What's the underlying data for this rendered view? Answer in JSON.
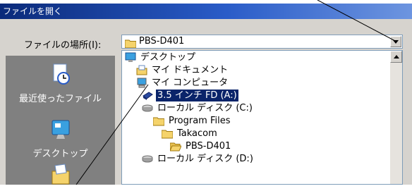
{
  "window": {
    "title": "ファイルを開く"
  },
  "lookin": {
    "label": "ファイルの場所(I):",
    "value": "PBS-D401"
  },
  "places": [
    {
      "label": "最近使ったファイル",
      "icon": "recent-documents-icon"
    },
    {
      "label": "デスクトップ",
      "icon": "desktop-icon"
    },
    {
      "label": "",
      "icon": "my-documents-icon"
    }
  ],
  "tree": [
    {
      "label": "デスクトップ",
      "icon": "desktop-icon",
      "selected": false
    },
    {
      "label": "マイ ドキュメント",
      "icon": "my-documents-icon",
      "selected": false
    },
    {
      "label": "マイ コンピュータ",
      "icon": "my-computer-icon",
      "selected": false
    },
    {
      "label": "3.5 インチ FD (A:)",
      "icon": "floppy-drive-icon",
      "selected": true
    },
    {
      "label": "ローカル ディスク (C:)",
      "icon": "hard-disk-icon",
      "selected": false
    },
    {
      "label": "Program Files",
      "icon": "folder-icon",
      "selected": false
    },
    {
      "label": "Takacom",
      "icon": "folder-icon",
      "selected": false
    },
    {
      "label": "PBS-D401",
      "icon": "open-folder-icon",
      "selected": false
    },
    {
      "label": "ローカル ディスク (D:)",
      "icon": "hard-disk-icon",
      "selected": false
    }
  ],
  "colors": {
    "title_bar": "#0a2a7a",
    "dialog_bg": "#d6d3ce",
    "places_bg": "#808080",
    "selection": "#0a246a",
    "folder": "#f5d36b"
  }
}
